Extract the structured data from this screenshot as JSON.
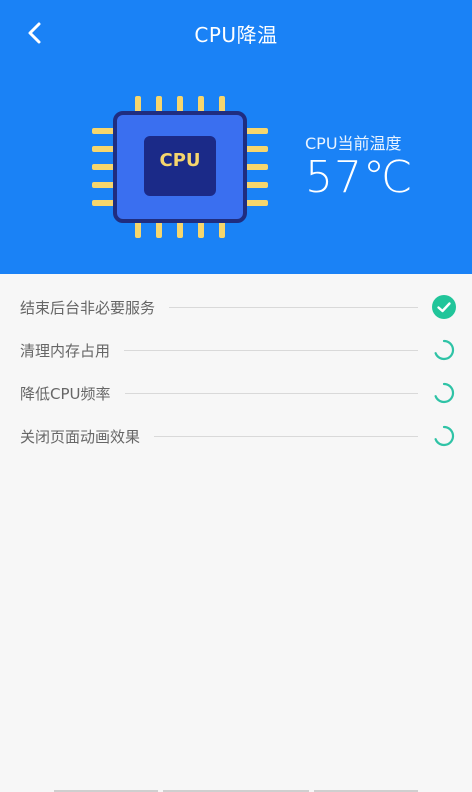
{
  "header": {
    "title": "CPU降温",
    "back_icon": "chevron-left-icon"
  },
  "chip": {
    "label": "CPU",
    "colors": {
      "body": "#3a6ff0",
      "outline": "#1f2d80",
      "core": "#1b2a88",
      "pins": "#f6d66d"
    }
  },
  "temperature": {
    "label": "CPU当前温度",
    "value": "57℃"
  },
  "tasks": [
    {
      "label": "结束后台非必要服务",
      "status": "done",
      "icon": "check-circle-icon"
    },
    {
      "label": "清理内存占用",
      "status": "loading",
      "icon": "spinner-icon"
    },
    {
      "label": "降低CPU频率",
      "status": "loading",
      "icon": "spinner-icon"
    },
    {
      "label": "关闭页面动画效果",
      "status": "loading",
      "icon": "spinner-icon"
    }
  ],
  "colors": {
    "accent": "#1a82f6",
    "done": "#21c59a",
    "spinner": "#2fc3a6"
  }
}
